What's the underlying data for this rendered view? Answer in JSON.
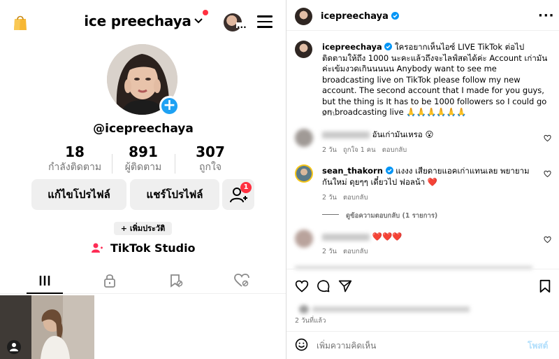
{
  "profile": {
    "username": "ice preechaya",
    "handle": "@icepreechaya",
    "stats": [
      {
        "value": "18",
        "label": "กำลังติดตาม"
      },
      {
        "value": "891",
        "label": "ผู้ติดตาม"
      },
      {
        "value": "307",
        "label": "ถูกใจ"
      }
    ],
    "edit_profile": "แก้ไขโปรไฟล์",
    "share_profile": "แชร์โปรไฟล์",
    "friend_badge": "1",
    "add_bio": "+ เพิ่มประวัติ",
    "studio": "TikTok Studio"
  },
  "post": {
    "author": "icepreechaya",
    "caption_line": "ใครอยากเห็นไอซ์ LIVE TikTok ต่อไปติดตามให้ถึง 1000 นะคะแล้วถึงจะไลฟ์สดได้ค่ะ Account เก่ามันค่ะเข้มงวดเกินนนนน Anybody want to see me broadcasting live on TikTok please follow my new account. The second account that I made for you guys, but the thing is It has to be 1000 followers so I could go on broadcasting live 🙏🙏🙏🙏🙏🙏",
    "caption_time": "2 วัน",
    "comments": [
      {
        "user": "",
        "text": "อันเก่ามันเหรอ 😮",
        "time": "2 วัน",
        "likes": "ถูกใจ 1 คน",
        "reply": "ตอบกลับ"
      },
      {
        "user": "sean_thakorn",
        "text": "แงงง เสียดายแอคเก่าแทนเลย พยายามกันใหม่ ดุยๆๆ เดี๋ยวไป ฟอลน้า ❤️",
        "time": "2 วัน",
        "reply": "ตอบกลับ",
        "view_replies": "ดูข้อความตอบกลับ (1 รายการ)"
      },
      {
        "user": "",
        "text": "❤️❤️❤️",
        "time": "2 วัน",
        "reply": "ตอบกลับ"
      }
    ],
    "posted_ago": "2 วันที่แล้ว",
    "add_comment_placeholder": "เพิ่มความคิดเห็น",
    "post_button": "โพสต์"
  },
  "colors": {
    "verified": "#0095f6",
    "badge_red": "#ff3040",
    "plus_blue": "#1ea1f3",
    "heart": "#ed1c24"
  }
}
